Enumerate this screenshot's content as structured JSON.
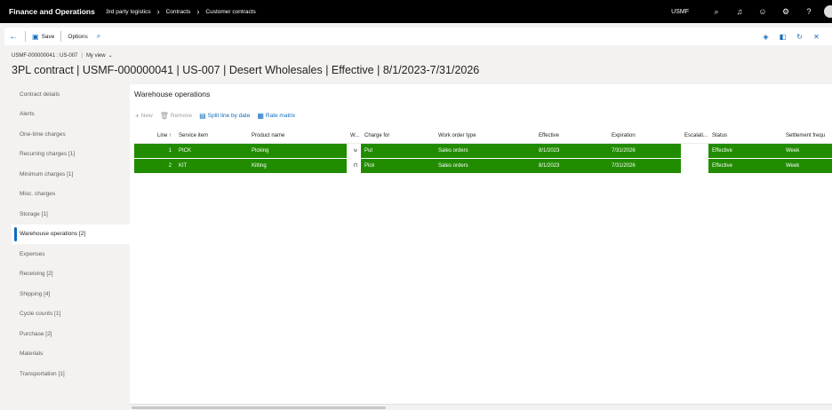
{
  "topbar": {
    "app_title": "Finance and Operations",
    "breadcrumbs": [
      "3rd party logistics",
      "Contracts",
      "Customer contracts"
    ],
    "company": "USMF",
    "icons": [
      "search-icon",
      "bell-icon",
      "smiley-icon",
      "gear-icon",
      "help-icon"
    ]
  },
  "actionbar": {
    "save_label": "Save",
    "options_label": "Options"
  },
  "identity": {
    "record": "USMF-000000041 : US-007",
    "view": "My view"
  },
  "page_title": "3PL contract | USMF-000000041 | US-007 | Desert Wholesales | Effective | 8/1/2023-7/31/2026",
  "sidebar": {
    "items": [
      {
        "label": "Contract details"
      },
      {
        "label": "Alerts"
      },
      {
        "label": "One-time charges"
      },
      {
        "label": "Recurring charges [1]"
      },
      {
        "label": "Minimum charges [1]"
      },
      {
        "label": "Misc. charges"
      },
      {
        "label": "Storage [1]"
      },
      {
        "label": "Warehouse operations [2]"
      },
      {
        "label": "Expenses"
      },
      {
        "label": "Receiving [2]"
      },
      {
        "label": "Shipping [4]"
      },
      {
        "label": "Cycle counts [1]"
      },
      {
        "label": "Purchase [2]"
      },
      {
        "label": "Materials"
      },
      {
        "label": "Transportation [1]"
      }
    ],
    "active_index": 7
  },
  "section": {
    "title": "Warehouse operations",
    "toolbar": {
      "new_label": "New",
      "remove_label": "Remove",
      "split_label": "Split line by date",
      "rate_label": "Rate matrix"
    }
  },
  "grid": {
    "columns": {
      "line": "Line",
      "service_item": "Service item",
      "product_name": "Product name",
      "w": "W...",
      "charge_for": "Charge for",
      "work_order_type": "Work order type",
      "effective": "Effective",
      "expiration": "Expiration",
      "escalation": "Escalati...",
      "status": "Status",
      "settlement": "Settlement frequ"
    },
    "rows": [
      {
        "line": "1",
        "service_item": "PICK",
        "product_name": "Picking",
        "charge_for": "Put",
        "work_order_type": "Sales orders",
        "effective": "8/1/2023",
        "expiration": "7/31/2026",
        "escalation": "",
        "status": "Effective",
        "settlement": "Week"
      },
      {
        "line": "2",
        "service_item": "KIT",
        "product_name": "Kitting",
        "charge_for": "Pick",
        "work_order_type": "Sales orders",
        "effective": "8/1/2023",
        "expiration": "7/31/2026",
        "escalation": "",
        "status": "Effective",
        "settlement": "Week"
      }
    ]
  },
  "colors": {
    "row_highlight": "#218c00",
    "accent": "#0f6cbd"
  }
}
